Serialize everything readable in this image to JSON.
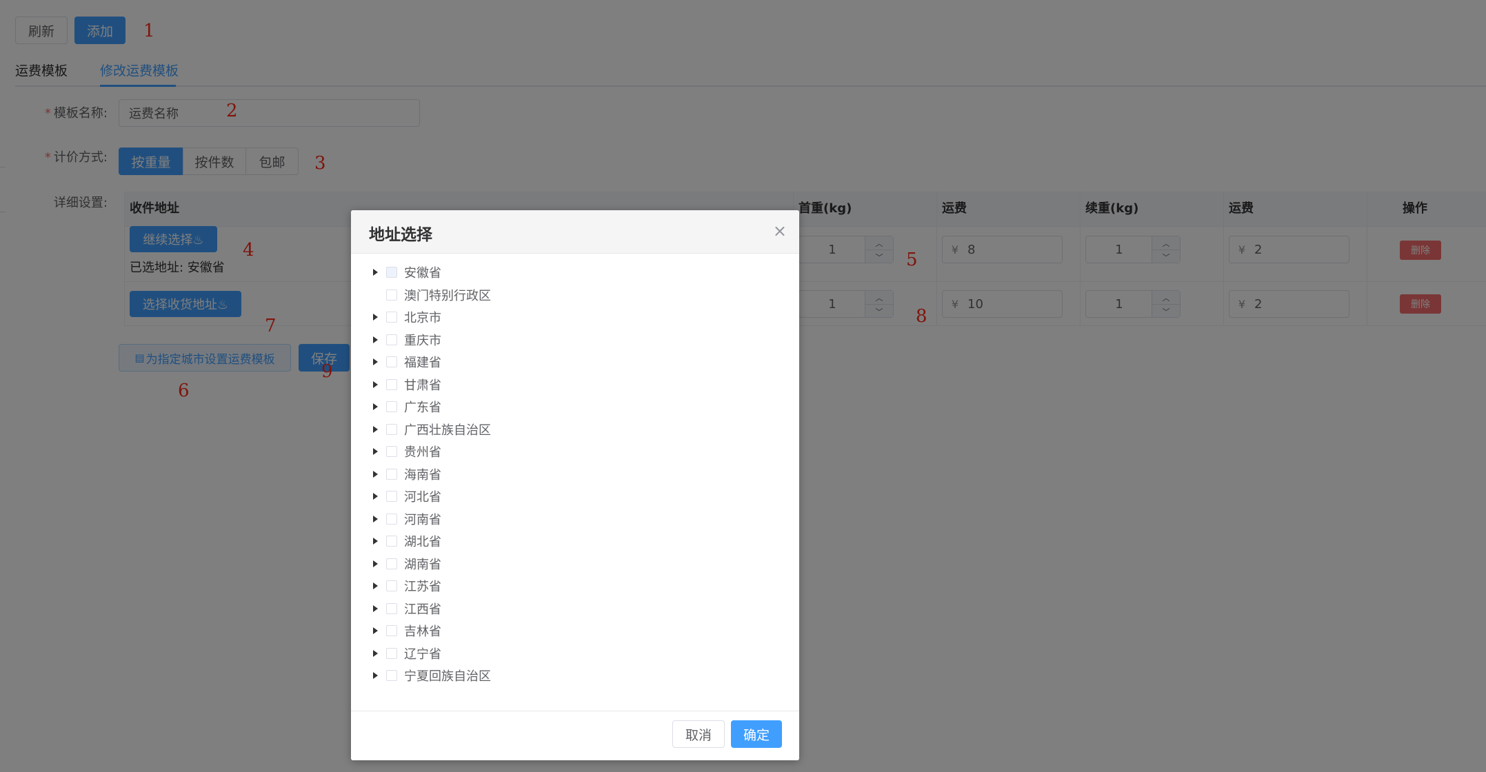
{
  "toolbar": {
    "refresh_label": "刷新",
    "add_label": "添加"
  },
  "tabs": [
    {
      "label": "运费模板"
    },
    {
      "label": "修改运费模板"
    }
  ],
  "form": {
    "name_label": "模板名称:",
    "name_placeholder": "运费名称",
    "pricing_label": "计价方式:",
    "pricing_options": [
      {
        "label": "按重量"
      },
      {
        "label": "按件数"
      },
      {
        "label": "包邮"
      }
    ],
    "pricing_selected": "按重量",
    "detail_label": "详细设置:"
  },
  "table": {
    "headers": {
      "address": "收件地址",
      "first_weight": "首重(kg)",
      "fee1": "运费",
      "extra_weight": "续重(kg)",
      "fee2": "运费",
      "action": "操作"
    },
    "rows": [
      {
        "select_label": "继续选择♨",
        "selected_text": "已选地址: 安徽省",
        "first_weight": "1",
        "fee1": "8",
        "extra_weight": "1",
        "fee2": "2",
        "delete_label": "删除"
      },
      {
        "select_label": "选择收货地址♨",
        "first_weight": "1",
        "fee1": "10",
        "extra_weight": "1",
        "fee2": "2",
        "delete_label": "删除"
      }
    ],
    "currency": "¥"
  },
  "actions": {
    "city_template_label": "为指定城市设置运费模板",
    "save_label": "保存"
  },
  "annotations": [
    "1",
    "2",
    "3",
    "4",
    "5",
    "6",
    "7",
    "8",
    "9"
  ],
  "dialog": {
    "title": "地址选择",
    "close": "×",
    "provinces": [
      {
        "label": "安徽省",
        "has_children": true,
        "disabled": true
      },
      {
        "label": "澳门特别行政区",
        "has_children": false
      },
      {
        "label": "北京市",
        "has_children": true
      },
      {
        "label": "重庆市",
        "has_children": true
      },
      {
        "label": "福建省",
        "has_children": true
      },
      {
        "label": "甘肃省",
        "has_children": true
      },
      {
        "label": "广东省",
        "has_children": true
      },
      {
        "label": "广西壮族自治区",
        "has_children": true
      },
      {
        "label": "贵州省",
        "has_children": true
      },
      {
        "label": "海南省",
        "has_children": true
      },
      {
        "label": "河北省",
        "has_children": true
      },
      {
        "label": "河南省",
        "has_children": true
      },
      {
        "label": "湖北省",
        "has_children": true
      },
      {
        "label": "湖南省",
        "has_children": true
      },
      {
        "label": "江苏省",
        "has_children": true
      },
      {
        "label": "江西省",
        "has_children": true
      },
      {
        "label": "吉林省",
        "has_children": true
      },
      {
        "label": "辽宁省",
        "has_children": true
      },
      {
        "label": "宁夏回族自治区",
        "has_children": true
      }
    ],
    "cancel_label": "取消",
    "confirm_label": "确定"
  },
  "colors": {
    "primary": "#409eff",
    "danger": "#f56c6c",
    "annotation": "#ff2a1a"
  }
}
